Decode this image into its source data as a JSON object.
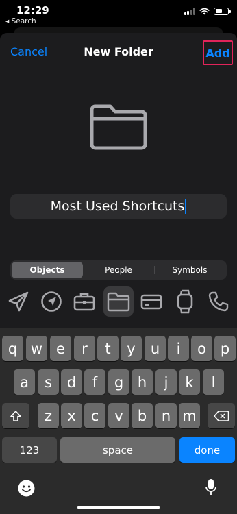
{
  "status_bar": {
    "time": "12:29",
    "back_app": "◂ Search"
  },
  "nav": {
    "cancel": "Cancel",
    "title": "New Folder",
    "add": "Add"
  },
  "folder_name_value": "Most Used Shortcuts",
  "tabs": [
    {
      "label": "Objects",
      "active": true
    },
    {
      "label": "People",
      "active": false
    },
    {
      "label": "Symbols",
      "active": false
    }
  ],
  "icons": [
    "paper-plane-icon",
    "compass-icon",
    "briefcase-icon",
    "folder-icon",
    "credit-card-icon",
    "watch-icon",
    "phone-icon"
  ],
  "selected_icon": "folder-icon",
  "keyboard": {
    "row1": [
      "q",
      "w",
      "e",
      "r",
      "t",
      "y",
      "u",
      "i",
      "o",
      "p"
    ],
    "row2": [
      "a",
      "s",
      "d",
      "f",
      "g",
      "h",
      "j",
      "k",
      "l"
    ],
    "row3": [
      "z",
      "x",
      "c",
      "v",
      "b",
      "n",
      "m"
    ],
    "numbers": "123",
    "space": "space",
    "done": "done"
  },
  "colors": {
    "accent": "#0a84ff",
    "highlight_border": "#e1245a",
    "sheet": "#1c1c1e",
    "keyboard": "#2b2b2b"
  }
}
